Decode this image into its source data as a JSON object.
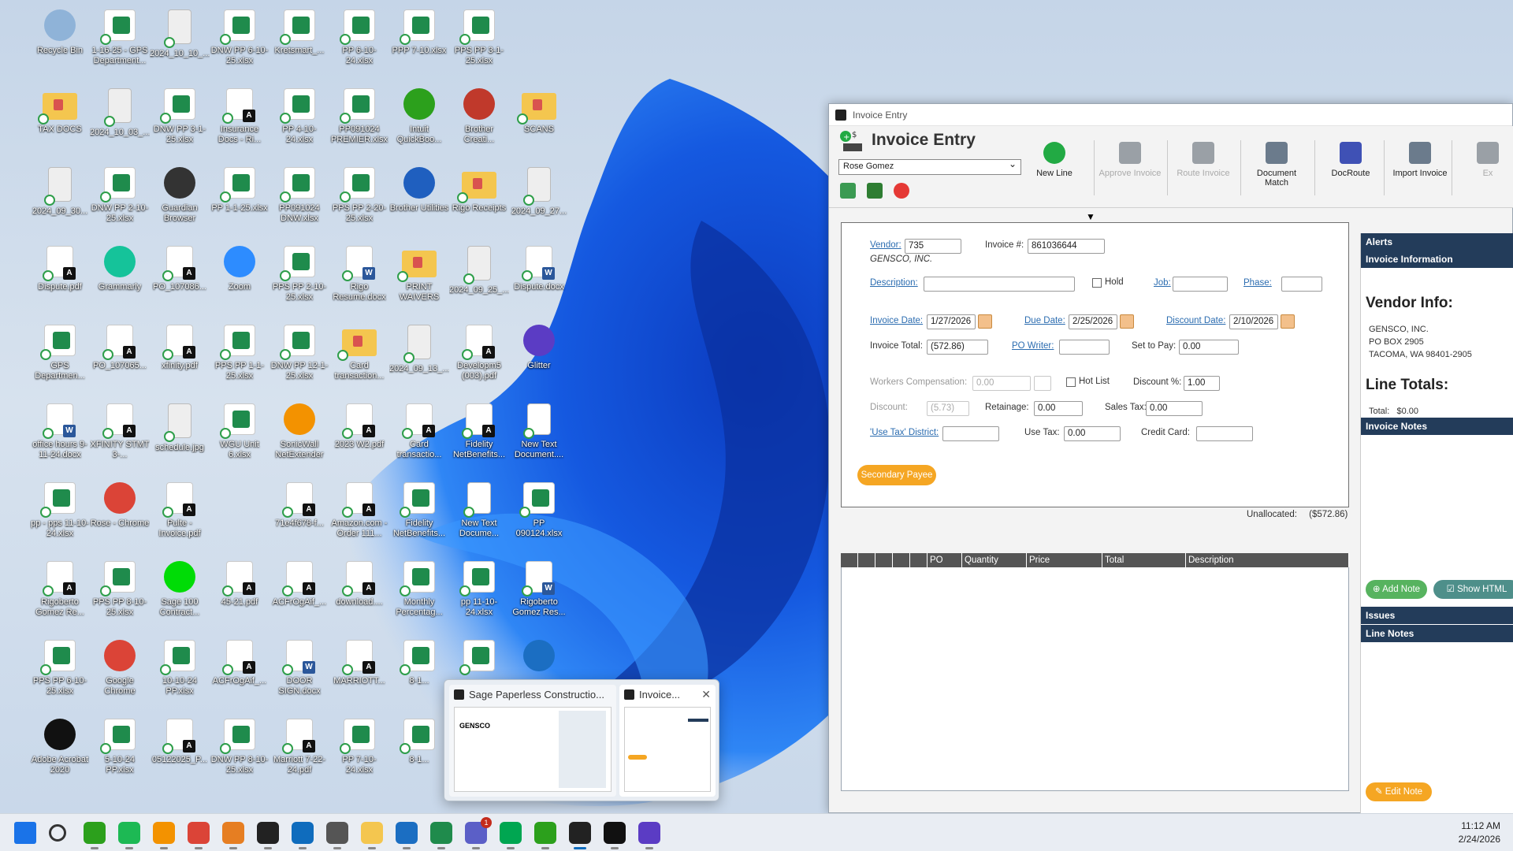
{
  "desktop": {
    "icons": [
      {
        "label": "Recycle Bin",
        "kind": "app",
        "color": "#8fb3d8"
      },
      {
        "label": "1-16-25 - GPS Department...",
        "kind": "excel"
      },
      {
        "label": "2024_10_10_...",
        "kind": "img"
      },
      {
        "label": "DNW PP 6-10-25.xlsx",
        "kind": "excel"
      },
      {
        "label": "Kretsmart_...",
        "kind": "excel"
      },
      {
        "label": "PP 6-10-24.xlsx",
        "kind": "excel"
      },
      {
        "label": "PPP 7-10.xlsx",
        "kind": "excel"
      },
      {
        "label": "PPS PP 3-1-25.xlsx",
        "kind": "excel"
      },
      {
        "label": "TAX DOCS",
        "kind": "folder"
      },
      {
        "label": "2024_10_03_...",
        "kind": "img"
      },
      {
        "label": "DNW PP 3-1-25.xlsx",
        "kind": "excel"
      },
      {
        "label": "Insurance Docs - Ri...",
        "kind": "pdf"
      },
      {
        "label": "PP 4-10-24.xlsx",
        "kind": "excel"
      },
      {
        "label": "PP091024 PREMIER.xlsx",
        "kind": "excel"
      },
      {
        "label": "Intuit QuickBoo...",
        "kind": "app",
        "color": "#2ca01c"
      },
      {
        "label": "Brother Creati...",
        "kind": "app",
        "color": "#c0392b"
      },
      {
        "label": "SCANS",
        "kind": "folder"
      },
      {
        "label": "2024_09_30...",
        "kind": "img"
      },
      {
        "label": "DNW PP 2-10-25.xlsx",
        "kind": "excel"
      },
      {
        "label": "Guardian Browser",
        "kind": "app",
        "color": "#333333"
      },
      {
        "label": "PP 1-1-25.xlsx",
        "kind": "excel"
      },
      {
        "label": "PP091024 DNW.xlsx",
        "kind": "excel"
      },
      {
        "label": "PPS PP 2-20-25.xlsx",
        "kind": "excel"
      },
      {
        "label": "Brother Utilities",
        "kind": "app",
        "color": "#1f5fbf"
      },
      {
        "label": "Rigo Receipts",
        "kind": "folder"
      },
      {
        "label": "2024_09_27...",
        "kind": "img"
      },
      {
        "label": "Dispute.pdf",
        "kind": "pdf"
      },
      {
        "label": "Grammarly",
        "kind": "app",
        "color": "#15c39a"
      },
      {
        "label": "PO_107086...",
        "kind": "pdf"
      },
      {
        "label": "Zoom",
        "kind": "app",
        "color": "#2d8cff"
      },
      {
        "label": "PPS PP 2-10-25.xlsx",
        "kind": "excel"
      },
      {
        "label": "Rigo Resume.docx",
        "kind": "doc"
      },
      {
        "label": "PRINT WAIVERS",
        "kind": "folder"
      },
      {
        "label": "2024_09_25_...",
        "kind": "img"
      },
      {
        "label": "Dispute.docx",
        "kind": "doc"
      },
      {
        "label": "GPS Departmen...",
        "kind": "excel"
      },
      {
        "label": "PO_107065...",
        "kind": "pdf"
      },
      {
        "label": "xfinity.pdf",
        "kind": "pdf"
      },
      {
        "label": "PPS PP 1-1-25.xlsx",
        "kind": "excel"
      },
      {
        "label": "DNW PP 12-1-25.xlsx",
        "kind": "excel"
      },
      {
        "label": "Card transaction...",
        "kind": "folder"
      },
      {
        "label": "2024_09_13_...",
        "kind": "img"
      },
      {
        "label": "Developm5 (003).pdf",
        "kind": "pdf"
      },
      {
        "label": "Glitter",
        "kind": "app",
        "color": "#5b3cc4"
      },
      {
        "label": "office hours 9-11-24.docx",
        "kind": "doc"
      },
      {
        "label": "XFINITY STMT 3-...",
        "kind": "pdf"
      },
      {
        "label": "schedule.jpg",
        "kind": "img"
      },
      {
        "label": "WGU Unit 6.xlsx",
        "kind": "excel"
      },
      {
        "label": "SonicWall NetExtender",
        "kind": "app",
        "color": "#f39200"
      },
      {
        "label": "2023 W2.pdf",
        "kind": "pdf"
      },
      {
        "label": "Card transactio...",
        "kind": "pdf"
      },
      {
        "label": "Fidelity NetBenefits...",
        "kind": "pdf"
      },
      {
        "label": "New Text Document....",
        "kind": "txt"
      },
      {
        "label": "pp - pps 11-10-24.xlsx",
        "kind": "excel"
      },
      {
        "label": "Rose - Chrome",
        "kind": "app",
        "color": "#db4437"
      },
      {
        "label": "Pulte - Invoice.pdf",
        "kind": "pdf"
      },
      {
        "label": "71e4f678-f...",
        "kind": "pdf"
      },
      {
        "label": "Amazon.com - Order 111...",
        "kind": "pdf"
      },
      {
        "label": "Fidelity NetBenefits...",
        "kind": "excel"
      },
      {
        "label": "New Text Docume...",
        "kind": "txt"
      },
      {
        "label": "PP 090124.xlsx",
        "kind": "excel"
      },
      {
        "label": "Rigoberto Gomez Re...",
        "kind": "pdf"
      },
      {
        "label": "PPS PP 8-10-25.xlsx",
        "kind": "excel"
      },
      {
        "label": "Sage 100 Contract...",
        "kind": "app",
        "color": "#00dc06"
      },
      {
        "label": "45-21.pdf",
        "kind": "pdf"
      },
      {
        "label": "ACFrOgAif_...",
        "kind": "pdf"
      },
      {
        "label": "download....",
        "kind": "pdf"
      },
      {
        "label": "Monthly Percentag...",
        "kind": "excel"
      },
      {
        "label": "pp 11-10-24.xlsx",
        "kind": "excel"
      },
      {
        "label": "Rigoberto Gomez Res...",
        "kind": "doc"
      },
      {
        "label": "PPS PP 6-10-25.xlsx",
        "kind": "excel"
      },
      {
        "label": "Google Chrome",
        "kind": "app",
        "color": "#db4437"
      },
      {
        "label": "10-10-24 PP.xlsx",
        "kind": "excel"
      },
      {
        "label": "ACFrOgAif_...",
        "kind": "pdf"
      },
      {
        "label": "DOOR SIGN.docx",
        "kind": "doc"
      },
      {
        "label": "MARRIOTT...",
        "kind": "pdf"
      },
      {
        "label": "8-1...",
        "kind": "excel"
      },
      {
        "label": "",
        "kind": "excel"
      },
      {
        "label": "",
        "kind": "app",
        "color": "#1b6ec2"
      },
      {
        "label": "Adobe Acrobat 2020",
        "kind": "app",
        "color": "#111111"
      },
      {
        "label": "5-10-24 PP.xlsx",
        "kind": "excel"
      },
      {
        "label": "05122025_P...",
        "kind": "pdf"
      },
      {
        "label": "DNW PP 8-10-25.xlsx",
        "kind": "excel"
      },
      {
        "label": "Marriott 7-22-24.pdf",
        "kind": "pdf"
      },
      {
        "label": "PP 7-10-24.xlsx",
        "kind": "excel"
      },
      {
        "label": "8-1...",
        "kind": "excel"
      }
    ]
  },
  "window": {
    "title": "Invoice Entry",
    "header_title": "Invoice Entry",
    "user_select": "Rose Gomez",
    "ribbon": [
      {
        "label": "New Line",
        "disabled": false,
        "icon": "plus-circle-icon",
        "color": "#22aa44"
      },
      {
        "label": "Approve Invoice",
        "disabled": true,
        "icon": "approve-invoice-icon",
        "color": "#9aa0a6"
      },
      {
        "label": "Route Invoice",
        "disabled": true,
        "icon": "route-invoice-icon",
        "color": "#9aa0a6"
      },
      {
        "label": "Document Match",
        "disabled": false,
        "icon": "document-match-icon",
        "color": "#6b7b8c"
      },
      {
        "label": "DocRoute",
        "disabled": false,
        "icon": "docroute-icon",
        "color": "#3f51b5"
      },
      {
        "label": "Import Invoice",
        "disabled": false,
        "icon": "import-invoice-icon",
        "color": "#6b7b8c"
      },
      {
        "label": "Ex",
        "disabled": true,
        "icon": "export-icon",
        "color": "#9aa0a6"
      }
    ],
    "form": {
      "vendor_label": "Vendor:",
      "vendor_value": "735",
      "vendor_name": "GENSCO, INC.",
      "invoice_no_label": "Invoice #:",
      "invoice_no_value": "861036644",
      "description_label": "Description:",
      "description_value": "",
      "hold_label": "Hold",
      "job_label": "Job:",
      "phase_label": "Phase:",
      "invoice_date_label": "Invoice Date:",
      "invoice_date_value": "1/27/2026",
      "due_date_label": "Due Date:",
      "due_date_value": "2/25/2026",
      "discount_date_label": "Discount Date:",
      "discount_date_value": "2/10/2026",
      "invoice_total_label": "Invoice Total:",
      "invoice_total_value": "(572.86)",
      "po_writer_label": "PO Writer:",
      "set_to_pay_label": "Set to Pay:",
      "set_to_pay_value": "0.00",
      "workers_comp_label": "Workers Compensation:",
      "workers_comp_value": "0.00",
      "hot_list_label": "Hot List",
      "discount_pct_label": "Discount %:",
      "discount_pct_value": "1.00",
      "discount_label": "Discount:",
      "discount_value": "(5.73)",
      "retainage_label": "Retainage:",
      "retainage_value": "0.00",
      "sales_tax_label": "Sales Tax:",
      "sales_tax_value": "0.00",
      "use_tax_district_label": "'Use Tax' District:",
      "use_tax_label": "Use Tax:",
      "use_tax_value": "0.00",
      "credit_card_label": "Credit Card:",
      "secondary_payee_label": "Secondary Payee",
      "unallocated_label": "Unallocated:",
      "unallocated_value": "($572.86)"
    },
    "grid_columns": [
      "",
      "",
      "",
      "",
      "",
      "PO Line",
      "Quantity",
      "Price",
      "Total",
      "Description"
    ],
    "right_panel": {
      "alerts": "Alerts",
      "invoice_information": "Invoice Information",
      "vendor_info_heading": "Vendor Info:",
      "vendor_lines": [
        "GENSCO, INC.",
        "PO BOX 2905",
        "TACOMA, WA 98401-2905"
      ],
      "line_totals_heading": "Line Totals:",
      "total_line": "Total:   $0.00",
      "invoice_notes": "Invoice Notes",
      "add_note": "Add Note",
      "show_html": "Show HTML",
      "issues": "Issues",
      "line_notes": "Line Notes",
      "edit_note": "Edit Note"
    }
  },
  "thumbnails": [
    {
      "title": "Sage Paperless Constructio..."
    },
    {
      "title": "Invoice..."
    }
  ],
  "taskbar": {
    "time": "11:12 AM",
    "date": "2/24/2026",
    "apps": [
      {
        "name": "start-icon",
        "color": "#1a73e8"
      },
      {
        "name": "search-icon",
        "color": "#333333"
      },
      {
        "name": "quickbooks-icon",
        "color": "#2ca01c"
      },
      {
        "name": "spotify-icon",
        "color": "#1db954"
      },
      {
        "name": "sonicwall-icon",
        "color": "#f39200"
      },
      {
        "name": "chrome-icon",
        "color": "#db4437"
      },
      {
        "name": "basketball-icon",
        "color": "#e67e22"
      },
      {
        "name": "sage-paperless-icon",
        "color": "#222222"
      },
      {
        "name": "outlook-icon",
        "color": "#0f6cbd"
      },
      {
        "name": "calculator-icon",
        "color": "#555555"
      },
      {
        "name": "file-explorer-icon",
        "color": "#f4c64f"
      },
      {
        "name": "remote-desktop-icon",
        "color": "#1b6ec2"
      },
      {
        "name": "excel-icon",
        "color": "#1f8b4c"
      },
      {
        "name": "teams-icon",
        "color": "#5b5fc7"
      },
      {
        "name": "sage-100-icon",
        "color": "#00a651"
      },
      {
        "name": "quickbooks-2-icon",
        "color": "#2ca01c"
      },
      {
        "name": "sage-paperless-2-icon",
        "color": "#222222"
      },
      {
        "name": "acrobat-icon",
        "color": "#111111"
      },
      {
        "name": "glitter-icon",
        "color": "#5b3cc4"
      }
    ],
    "teams_badge": "1"
  }
}
